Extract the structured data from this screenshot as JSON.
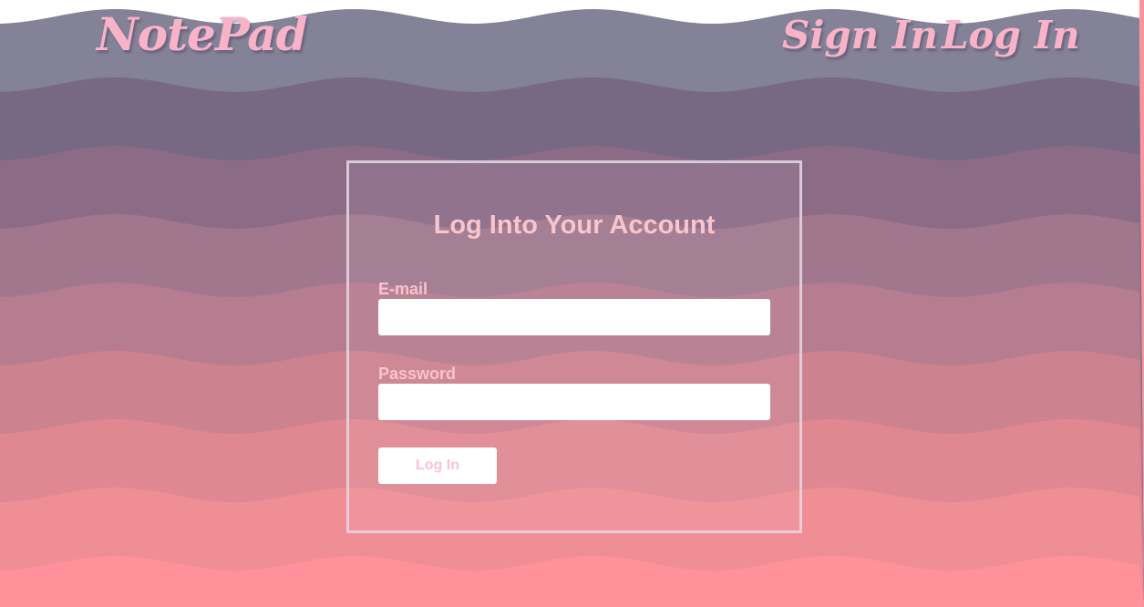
{
  "header": {
    "brand": "NotePad",
    "nav": {
      "sign_in": "Sign In",
      "log_in": "Log In"
    }
  },
  "login_form": {
    "title": "Log Into Your Account",
    "email_label": "E-mail",
    "email_value": "",
    "password_label": "Password",
    "password_value": "",
    "submit_label": "Log In"
  },
  "colors": {
    "accent_pink": "#f8b3c9",
    "wave_top": "#848397",
    "wave_bottom": "#fe919a",
    "card_border": "#e6d7e4"
  }
}
